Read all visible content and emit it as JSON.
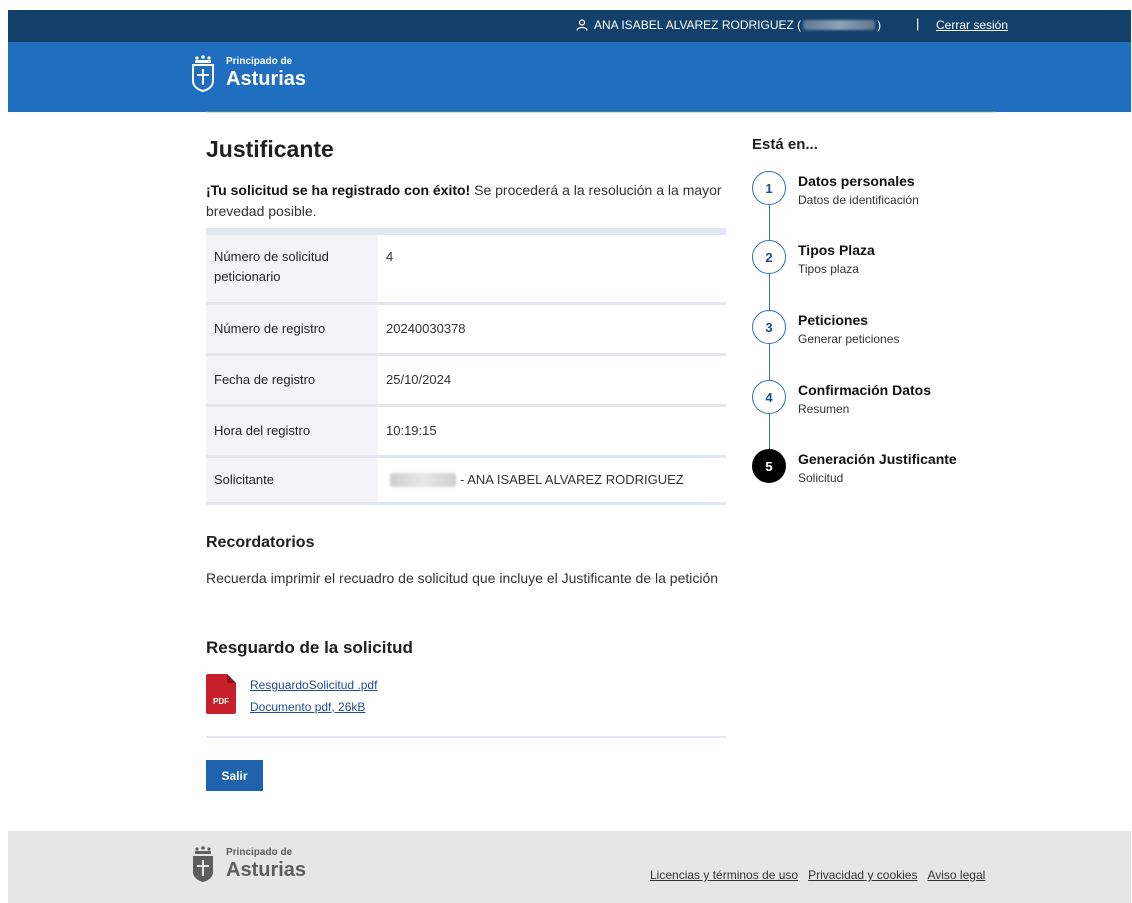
{
  "topbar": {
    "user_prefix": "ANA ISABEL ALVAREZ RODRIGUEZ (",
    "user_suffix": ")",
    "separator": "|",
    "logout": "Cerrar sesión"
  },
  "brand": {
    "line1": "Principado de",
    "line2": "Asturias"
  },
  "main": {
    "title": "Justificante",
    "intro_bold": "¡Tu solicitud se ha registrado con éxito!",
    "intro_rest": " Se procederá a la resolución a la mayor brevedad posible.",
    "rows": [
      {
        "label": "Número de solicitud peticionario",
        "value": "4"
      },
      {
        "label": "Número de registro",
        "value": "20240030378"
      },
      {
        "label": "Fecha de registro",
        "value": "25/10/2024"
      },
      {
        "label": "Hora del registro",
        "value": "10:19:15"
      },
      {
        "label": "Solicitante",
        "value": "- ANA ISABEL ALVAREZ RODRIGUEZ"
      }
    ],
    "reminders_title": "Recordatorios",
    "reminders_text": "Recuerda imprimir el recuadro de solicitud que incluye el Justificante de la petición",
    "receipt_title": "Resguardo de la solicitud",
    "file_name": "ResguardoSolicitud .pdf",
    "file_meta": "Documento pdf, 26kB",
    "pdf_badge": "PDF",
    "exit_button": "Salir"
  },
  "steps": {
    "title": "Está en...",
    "items": [
      {
        "num": "1",
        "title": "Datos personales",
        "subtitle": "Datos de identificación"
      },
      {
        "num": "2",
        "title": "Tipos Plaza",
        "subtitle": "Tipos plaza"
      },
      {
        "num": "3",
        "title": "Peticiones",
        "subtitle": "Generar peticiones"
      },
      {
        "num": "4",
        "title": "Confirmación Datos",
        "subtitle": "Resumen"
      },
      {
        "num": "5",
        "title": "Generación Justificante",
        "subtitle": "Solicitud"
      }
    ],
    "active_index": 4
  },
  "footer": {
    "links": [
      "Licencias y términos de uso",
      "Privacidad y cookies",
      "Aviso legal"
    ]
  },
  "colors": {
    "topbar": "#13406b",
    "header": "#1f6ebf",
    "button": "#1f63ad",
    "pdf_red": "#c8202a"
  },
  "icons": {
    "user": "user-icon",
    "crest": "asturias-crest-icon",
    "pdf": "pdf-file-icon"
  }
}
